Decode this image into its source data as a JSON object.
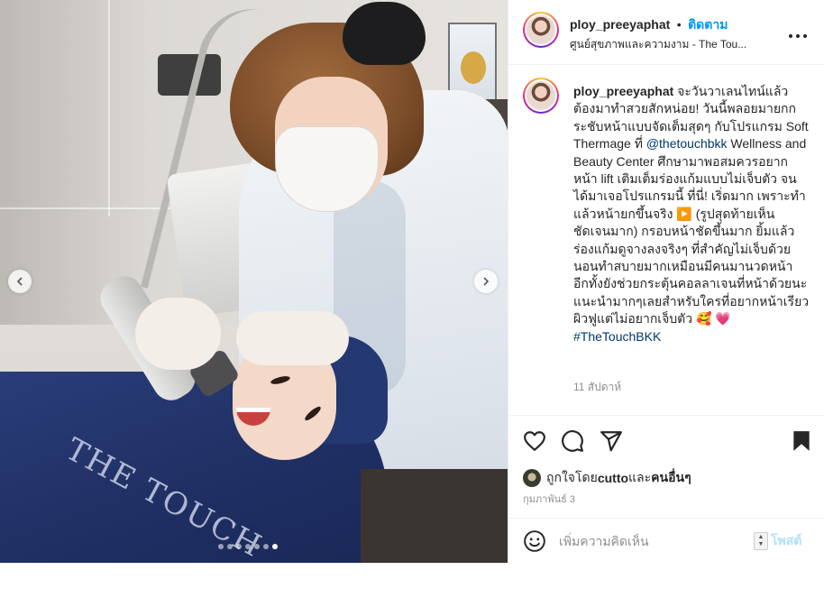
{
  "post": {
    "username": "ploy_preeyaphat",
    "separator": "•",
    "follow_label": "ติดตาม",
    "location": "ศูนย์สุขภาพและความงาม - The Tou...",
    "more_icon": "more-horizontal-icon",
    "caption": {
      "username": "ploy_preeyaphat",
      "text_before_mention": " จะวันวาเลนไทน์แล้วต้องมาทำสวยสักหน่อย! วันนี้พลอยมายกกระชับหน้าแบบจัดเต็มสุดๆ กับโปรแกรม Soft Thermage ที่ ",
      "mention": "@thetouchbkk",
      "text_after_mention": " Wellness and Beauty Center ศึกษามาพอสมควรอยากหน้า lift เติมเต็มร่องแก้มแบบไม่เจ็บตัว จนได้มาเจอโปรแกรมนี้ ที่นี่! เริ่ดมาก เพราะทำแล้วหน้ายกขึ้นจริง ▶️ (รูปสุดท้ายเห็นชัดเจนมาก) กรอบหน้าชัดขึ้นมาก ยิ้มแล้วร่องแก้มดูจางลงจริงๆ ที่สำคัญไม่เจ็บด้วยนอนทำสบายมากเหมือนมีคนมานวดหน้า อีกทั้งยังช่วยกระตุ้นคอลลาเจนที่หน้าด้วยนะ แนะนำมากๆเลยสำหรับใครที่อยากหน้าเรียว ผิวฟูแต่ไม่อยากเจ็บตัว 🥰 💗 ",
      "hashtag": "#TheTouchBKK"
    },
    "time_ago": "11 สัปดาห์",
    "liked_by_prefix": "ถูกใจโดย ",
    "liked_by_user": "cutto",
    "liked_by_mid": " และ",
    "liked_by_others": "คนอื่นๆ",
    "post_date": "กุมภาพันธ์ 3"
  },
  "media": {
    "bib_text": "THE TOUCH",
    "slide_count": 7,
    "active_slide": 6
  },
  "comment": {
    "placeholder": "เพิ่มความคิดเห็น",
    "post_label": "โพสต์"
  },
  "colors": {
    "accent": "#0095f6",
    "text": "#262626",
    "muted": "#8e8e8e",
    "link": "#00376b"
  }
}
